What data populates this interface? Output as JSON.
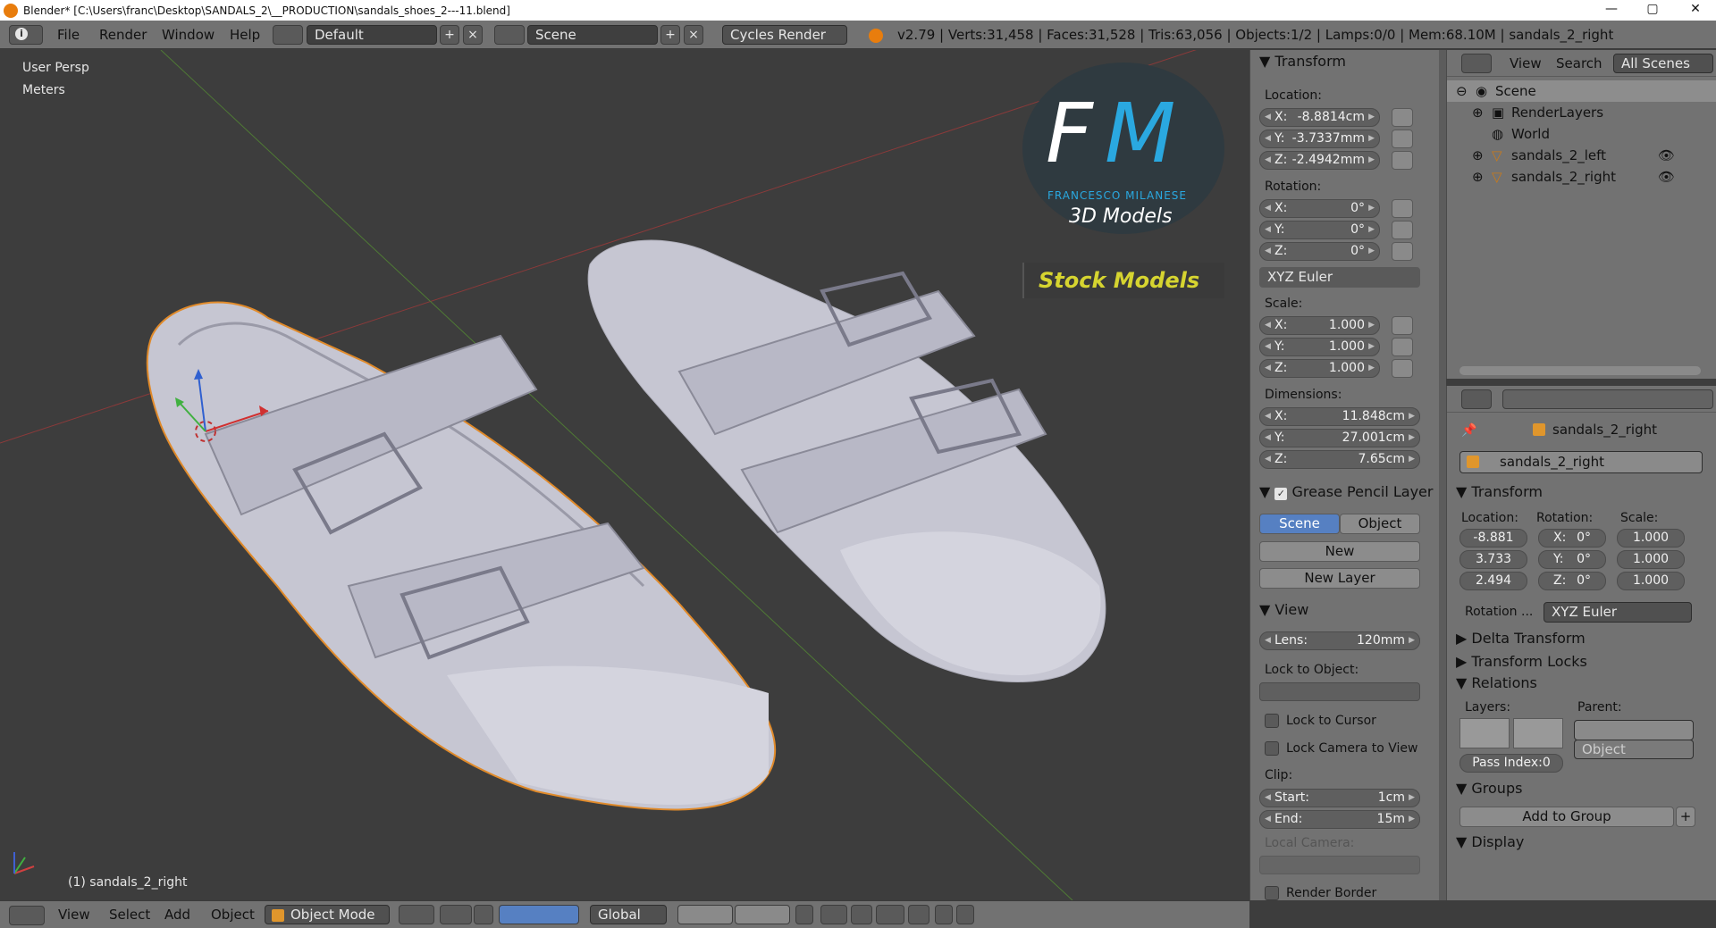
{
  "window": {
    "title": "Blender* [C:\\Users\\franc\\Desktop\\SANDALS_2\\__PRODUCTION\\sandals_shoes_2---11.blend]",
    "minimize": "—",
    "maximize": "▢",
    "close": "✕"
  },
  "header": {
    "menu": [
      "File",
      "Render",
      "Window",
      "Help"
    ],
    "screen_layout": "Default",
    "scene": "Scene",
    "render_engine": "Cycles Render",
    "stats": "v2.79 | Verts:31,458 | Faces:31,528 | Tris:63,056 | Objects:1/2 | Lamps:0/0 | Mem:68.10M | sandals_2_right"
  },
  "viewport": {
    "view_name": "User Persp",
    "units": "Meters",
    "active_object": "(1) sandals_2_right",
    "watermark": {
      "big_left": "F",
      "big_right": "M",
      "author": "FRANCESCO MILANESE",
      "line2": "3D Models",
      "banner": "Stock Models"
    }
  },
  "transform_panel": {
    "title": "Transform",
    "location_label": "Location:",
    "location": [
      {
        "axis": "X:",
        "value": "-8.8814cm"
      },
      {
        "axis": "Y:",
        "value": "-3.7337mm"
      },
      {
        "axis": "Z:",
        "value": "-2.4942mm"
      }
    ],
    "rotation_label": "Rotation:",
    "rotation": [
      {
        "axis": "X:",
        "value": "0°"
      },
      {
        "axis": "Y:",
        "value": "0°"
      },
      {
        "axis": "Z:",
        "value": "0°"
      }
    ],
    "rotation_mode": "XYZ Euler",
    "scale_label": "Scale:",
    "scale": [
      {
        "axis": "X:",
        "value": "1.000"
      },
      {
        "axis": "Y:",
        "value": "1.000"
      },
      {
        "axis": "Z:",
        "value": "1.000"
      }
    ],
    "dimensions_label": "Dimensions:",
    "dimensions": [
      {
        "axis": "X:",
        "value": "11.848cm"
      },
      {
        "axis": "Y:",
        "value": "27.001cm"
      },
      {
        "axis": "Z:",
        "value": "7.65cm"
      }
    ]
  },
  "grease_pencil": {
    "title": "Grease Pencil Layer",
    "tabs": [
      "Scene",
      "Object"
    ],
    "new": "New",
    "new_layer": "New Layer"
  },
  "view_panel": {
    "title": "View",
    "lens_label": "Lens:",
    "lens_value": "120mm",
    "lock_to_object": "Lock to Object:",
    "lock_to_cursor": "Lock to Cursor",
    "lock_camera": "Lock Camera to View",
    "clip": "Clip:",
    "clip_start_label": "Start:",
    "clip_start": "1cm",
    "clip_end_label": "End:",
    "clip_end": "15m",
    "local_camera": "Local Camera:",
    "render_border": "Render Border"
  },
  "outliner": {
    "menu": [
      "View",
      "Search"
    ],
    "filter": "All Scenes",
    "items": [
      {
        "label": "Scene"
      },
      {
        "label": "RenderLayers"
      },
      {
        "label": "World"
      },
      {
        "label": "sandals_2_left"
      },
      {
        "label": "sandals_2_right"
      }
    ]
  },
  "object_props": {
    "breadcrumb": "sandals_2_right",
    "object_name": "sandals_2_right",
    "transform_title": "Transform",
    "location_label": "Location:",
    "rotation_label": "Rotation:",
    "scale_label": "Scale:",
    "location": [
      "-8.881",
      "3.733",
      "2.494"
    ],
    "rotation": [
      {
        "axis": "X:",
        "value": "0°"
      },
      {
        "axis": "Y:",
        "value": "0°"
      },
      {
        "axis": "Z:",
        "value": "0°"
      }
    ],
    "scale": [
      "1.000",
      "1.000",
      "1.000"
    ],
    "rotation_mode_label": "Rotation ...",
    "rotation_mode": "XYZ Euler",
    "delta_transform": "Delta Transform",
    "transform_locks": "Transform Locks",
    "relations": "Relations",
    "layers": "Layers:",
    "parent": "Parent:",
    "parent_type": "Object",
    "pass_index": "Pass Index:0",
    "groups": "Groups",
    "add_to_group": "Add to Group",
    "display": "Display"
  },
  "bottombar": {
    "menu": [
      "View",
      "Select",
      "Add",
      "Object"
    ],
    "mode": "Object Mode",
    "orientation": "Global"
  }
}
